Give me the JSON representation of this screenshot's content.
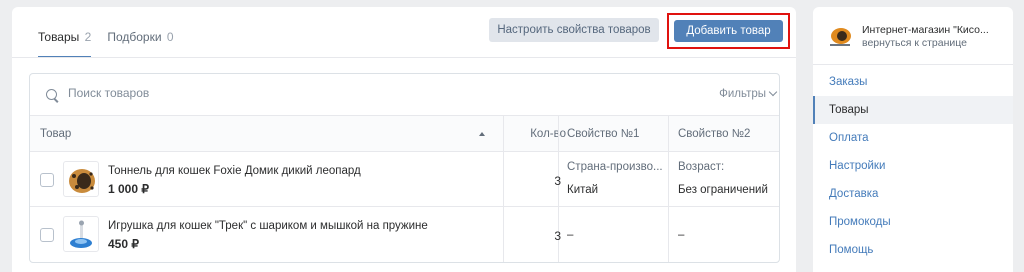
{
  "tabs": [
    {
      "label": "Товары",
      "count": "2"
    },
    {
      "label": "Подборки",
      "count": "0"
    }
  ],
  "toolbar": {
    "props_label": "Настроить свойства товаров",
    "add_label": "Добавить товар"
  },
  "search": {
    "placeholder": "Поиск товаров"
  },
  "filters_label": "Фильтры",
  "columns": [
    "Товар",
    "Кол-во",
    "Свойство №1",
    "Свойство №2"
  ],
  "products": [
    {
      "name": "Тоннель для кошек Foxie Домик дикий леопард",
      "price": "1 000 ₽",
      "qty": "3",
      "prop1_label": "Страна-произво...",
      "prop1_value": "Китай",
      "prop2_label": "Возраст:",
      "prop2_value": "Без ограничений"
    },
    {
      "name": "Игрушка для кошек \"Трек\" с шариком и мышкой на пружине",
      "price": "450 ₽",
      "qty": "3",
      "prop1_value": "–",
      "prop2_value": "–"
    }
  ],
  "sidebar": {
    "shop_name": "Интернет-магазин \"Кисо...",
    "shop_sub": "вернуться к странице",
    "items": [
      "Заказы",
      "Товары",
      "Оплата",
      "Настройки",
      "Доставка",
      "Промокоды",
      "Помощь"
    ],
    "active_index": 1
  },
  "colors": {
    "accent": "#5181b8",
    "highlight": "#e0120f",
    "link": "#447bba"
  }
}
